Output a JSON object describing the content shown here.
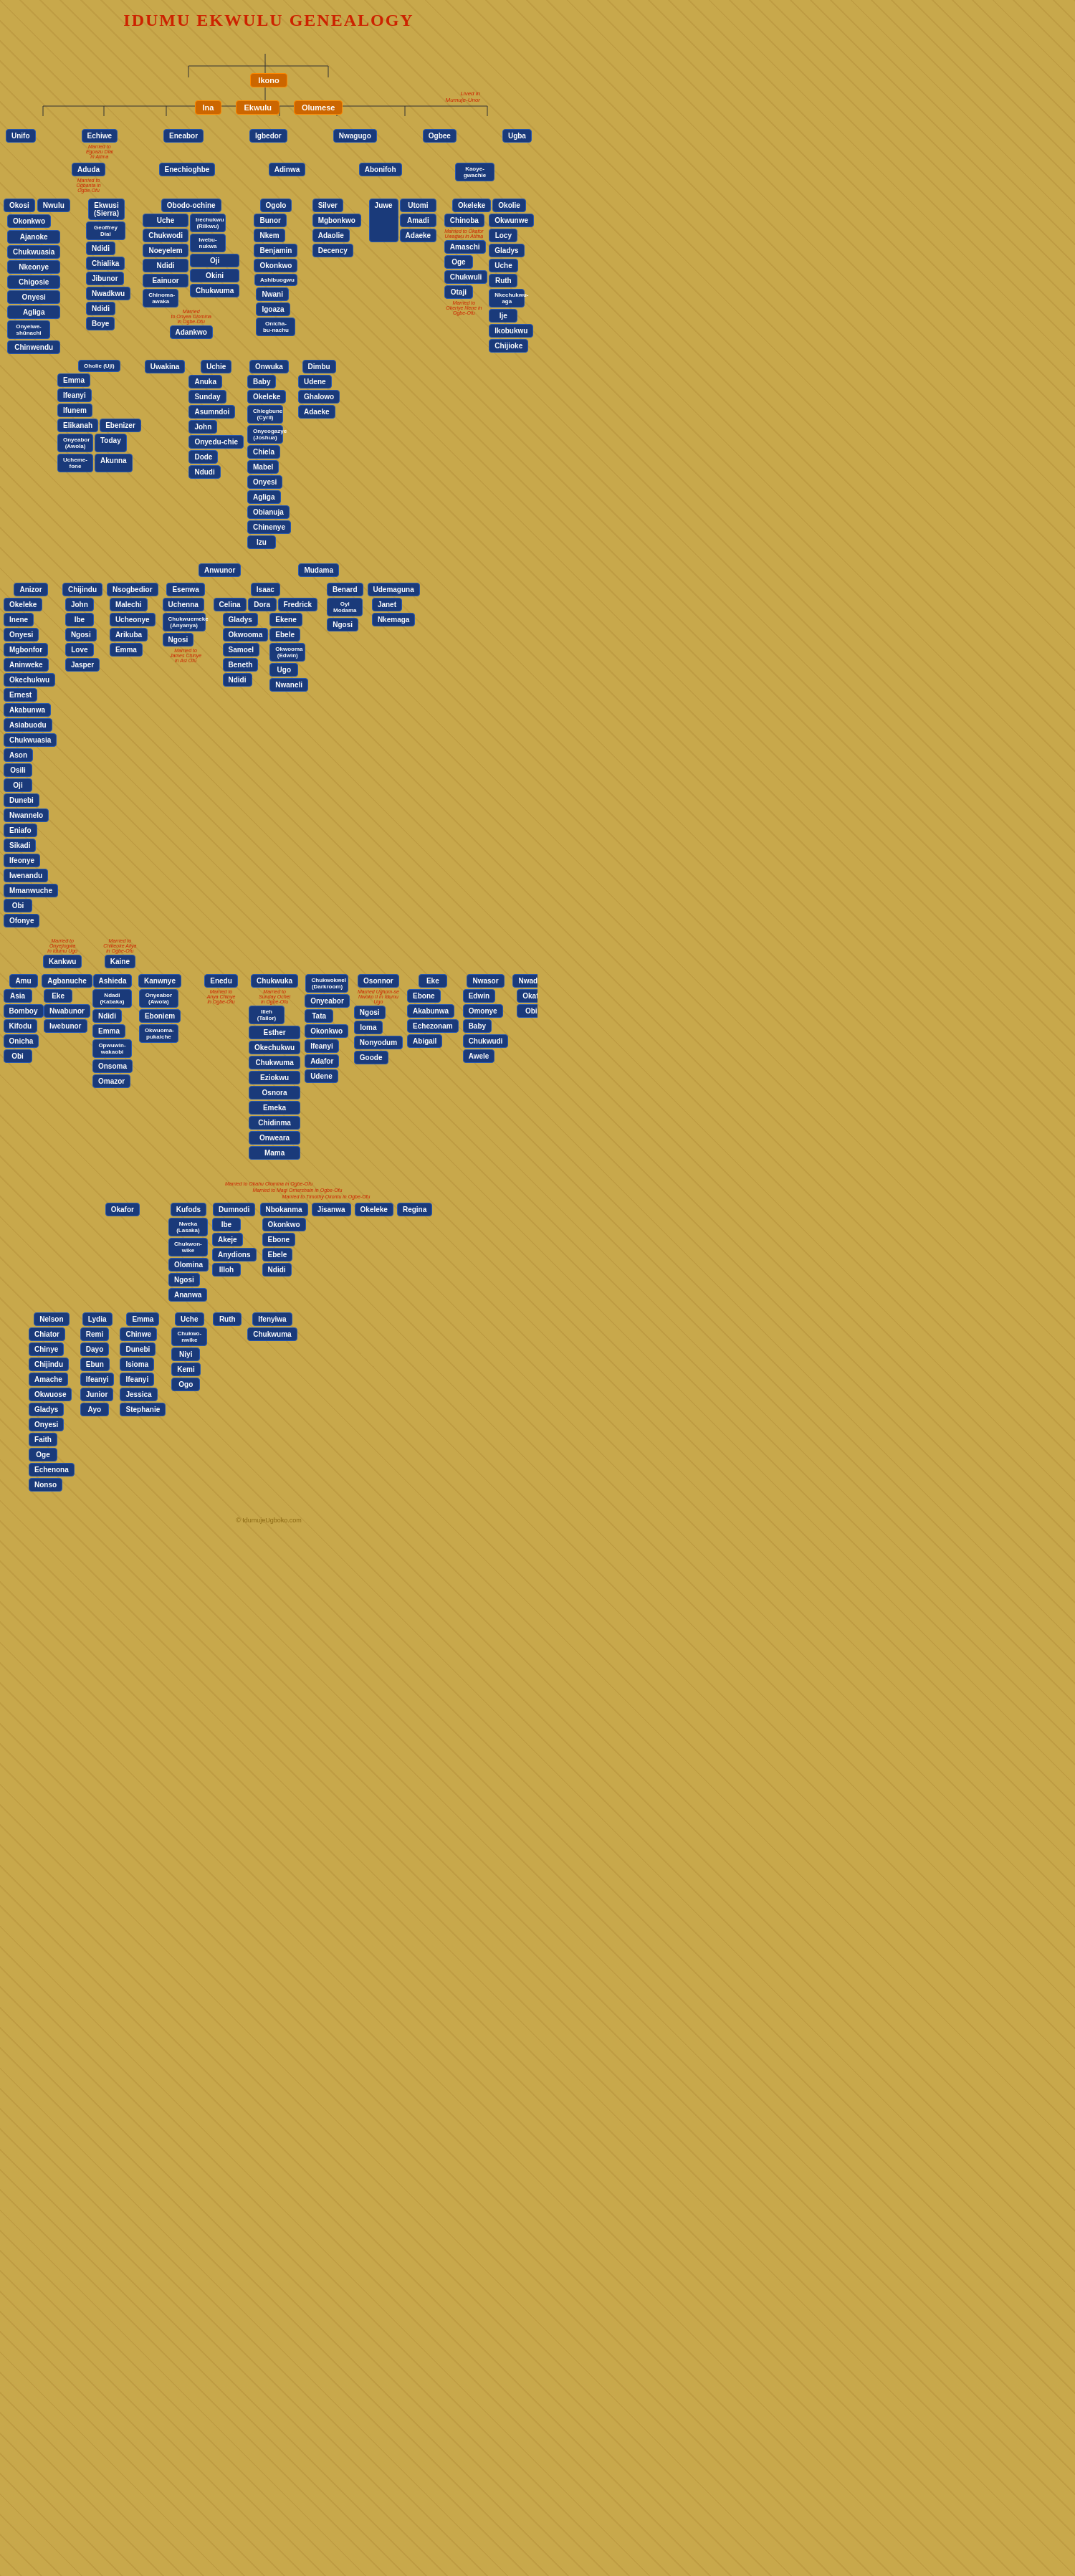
{
  "title": "IDUMU EKWULU GENEALOGY",
  "root": "Ikono",
  "level1": [
    "Ina",
    "Ekwulu",
    "Olumese"
  ],
  "note1": "Lived in Mumuje-Unor",
  "level2": {
    "nodes": [
      "Unifo",
      "Echiwe",
      "Eneabor",
      "Igbedor",
      "Nwagugo",
      "Ogbee",
      "Ugba"
    ],
    "note1": "Married to Egoazu Diai in Atima"
  },
  "footer": "© IdumujeUgboko.com"
}
